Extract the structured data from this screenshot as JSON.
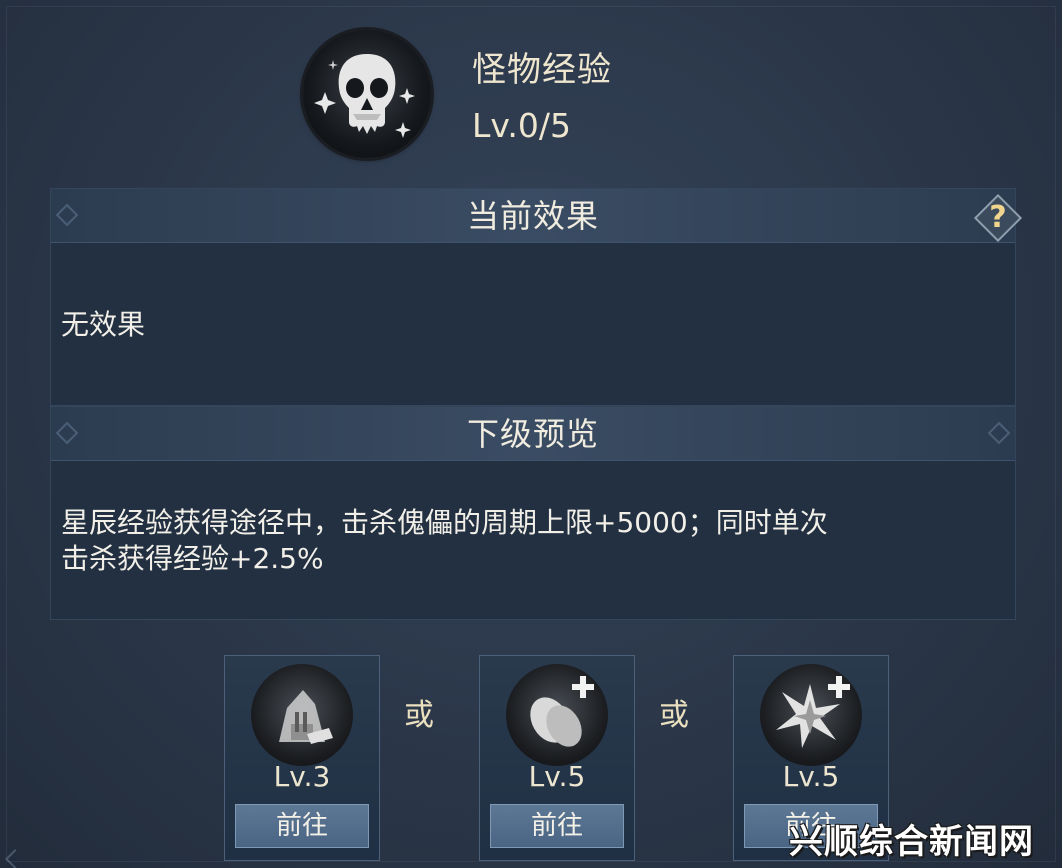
{
  "skill": {
    "title": "怪物经验",
    "level": "Lv.0/5",
    "icon": "skull-icon"
  },
  "current_effect": {
    "header": "当前效果",
    "help_label": "?",
    "text": "无效果"
  },
  "next_preview": {
    "header": "下级预览",
    "text_line1": "星辰经验获得途径中，击杀傀儡的周期上限+5000；同时单次",
    "text_line2": "击杀获得经验+2.5%"
  },
  "sources": [
    {
      "icon": "crafting-station-icon",
      "level": "Lv.3",
      "button": "前往"
    },
    {
      "icon": "egg-plus-icon",
      "level": "Lv.5",
      "button": "前往"
    },
    {
      "icon": "crystal-plus-icon",
      "level": "Lv.5",
      "button": "前往"
    }
  ],
  "separators": [
    "或",
    "或"
  ],
  "watermark": "兴顺综合新闻网",
  "colors": {
    "background": "#2b3749",
    "panel": "#223041",
    "accent_gold": "#f1d58f",
    "button_blue": "#5d7895"
  }
}
